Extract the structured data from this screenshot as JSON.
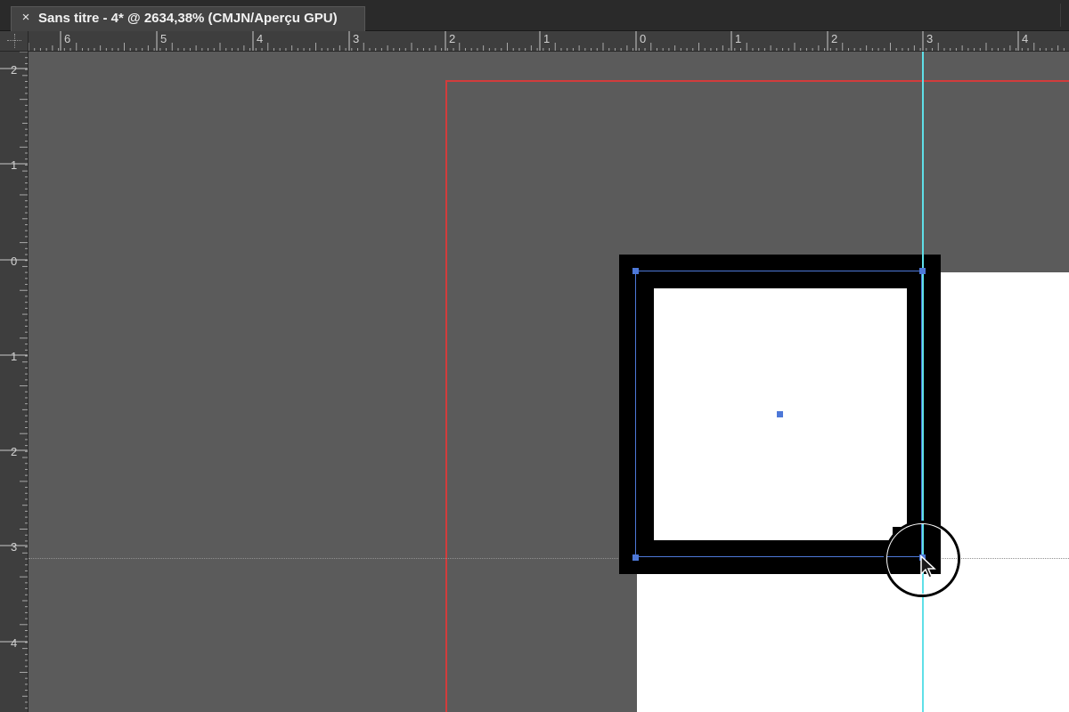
{
  "app": {
    "tab": {
      "close_icon": "×",
      "title": "Sans titre - 4* @ 2634,38% (CMJN/Aperçu GPU)"
    }
  },
  "rulers": {
    "horizontal_labels": [
      "6",
      "5",
      "4",
      "3",
      "2",
      "1",
      "0",
      "1",
      "2",
      "3",
      "4"
    ],
    "vertical_labels": [
      "2",
      "1",
      "0",
      "1",
      "2",
      "3",
      "4"
    ]
  },
  "colors": {
    "canvas": "#5b5b5b",
    "ruler": "#3e3e3e",
    "bleed_guide": "#d23c3c",
    "smart_guide": "#5fe0e8",
    "selection": "#4d78d8",
    "artboard": "#ffffff",
    "stroke": "#000000"
  },
  "icons": {
    "tab_close": "close-icon",
    "cursor": "arrow-cursor-icon",
    "cursor_highlight": "cursor-highlight-circle"
  }
}
